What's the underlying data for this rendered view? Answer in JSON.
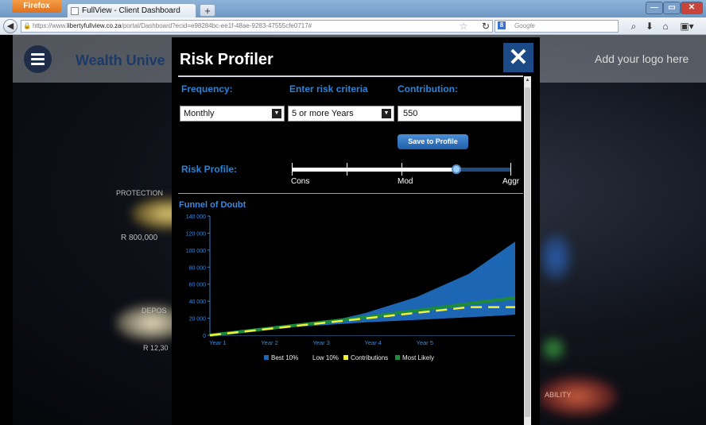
{
  "browser": {
    "firefox_label": "Firefox",
    "tab_title": "FullView - Client Dashboard",
    "new_tab": "+",
    "url_prefix": "https://www.",
    "url_domain": "libertyfullview.co.za",
    "url_path": "/portal/Dashboard?ecid=e98284bc-ee1f-48ae-9283-47555cfe0717#",
    "search_placeholder": "Google",
    "search_engine_badge": "8"
  },
  "page": {
    "brand": "Wealth Unive",
    "logo_placeholder": "Add your logo here",
    "side_labels": [
      "PROTECTION",
      "R 800,000",
      "DEPOS",
      "R 12,30",
      "ABILITY"
    ]
  },
  "modal": {
    "title": "Risk Profiler",
    "close": "✕",
    "frequency_label": "Frequency:",
    "criteria_label": "Enter risk criteria",
    "contribution_label": "Contribution:",
    "frequency_value": "Monthly",
    "criteria_value": "5 or more Years",
    "contribution_value": "550",
    "save_button": "Save to Profile",
    "risk_profile_label": "Risk Profile:",
    "risk_scale": [
      "Cons",
      "Mod",
      "Aggr"
    ],
    "risk_level": 0.75,
    "chart_title": "Funnel of Doubt"
  },
  "chart_data": {
    "type": "area",
    "title": "Funnel of Doubt",
    "ylim": [
      0,
      140000
    ],
    "y_ticks": [
      "140 000",
      "120 000",
      "100 000",
      "80 000",
      "60 000",
      "40 000",
      "20 000",
      "0"
    ],
    "categories": [
      "Year 1",
      "Year 2",
      "Year 3",
      "Year 4",
      "Year 5"
    ],
    "x": [
      0,
      1,
      2,
      3,
      4,
      5,
      5.9
    ],
    "series": [
      {
        "name": "Best 10%",
        "values": [
          0,
          4000,
          12000,
          26000,
          45000,
          72000,
          110000
        ],
        "color": "#1d66b3"
      },
      {
        "name": "Low 10%",
        "values": [
          0,
          6000,
          11000,
          15000,
          18000,
          21000,
          24000
        ],
        "color": "#000000"
      },
      {
        "name": "Contributions",
        "values": [
          0,
          6600,
          13200,
          19800,
          26400,
          33000,
          33000
        ],
        "color": "#f1f03b"
      },
      {
        "name": "Most Likely",
        "values": [
          0,
          7000,
          14000,
          21000,
          29000,
          37000,
          44000
        ],
        "color": "#1c8b3a"
      }
    ],
    "legend": [
      "Best 10%",
      "Low 10%",
      "Contributions",
      "Most Likely"
    ]
  }
}
